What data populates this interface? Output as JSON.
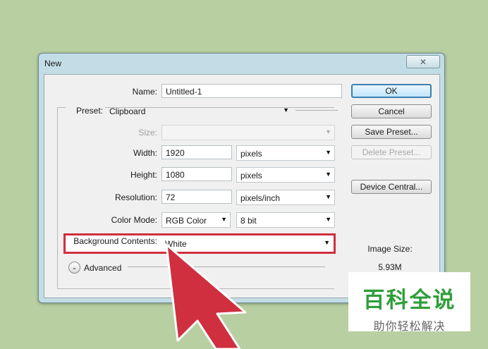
{
  "dialog": {
    "title": "New",
    "close_symbol": "✕"
  },
  "form": {
    "name_label": "Name:",
    "name_value": "Untitled-1",
    "preset_label": "Preset:",
    "preset_value": "Clipboard",
    "size_label": "Size:",
    "size_value": "",
    "width_label": "Width:",
    "width_value": "1920",
    "width_unit": "pixels",
    "height_label": "Height:",
    "height_value": "1080",
    "height_unit": "pixels",
    "resolution_label": "Resolution:",
    "resolution_value": "72",
    "resolution_unit": "pixels/inch",
    "color_mode_label": "Color Mode:",
    "color_mode_value": "RGB Color",
    "bit_depth_value": "8 bit",
    "background_label": "Background Contents:",
    "background_value": "White",
    "advanced_label": "Advanced"
  },
  "buttons": {
    "ok": "OK",
    "cancel": "Cancel",
    "save_preset": "Save Preset...",
    "delete_preset": "Delete Preset...",
    "device_central": "Device Central..."
  },
  "image_size": {
    "label": "Image Size:",
    "value": "5.93M"
  },
  "watermark": {
    "title": "百科全说",
    "subtitle": "助你轻松解决"
  },
  "colors": {
    "highlight": "#cf2f3f",
    "watermark_green": "#2f9e3a",
    "background": "#b8cfa2"
  }
}
